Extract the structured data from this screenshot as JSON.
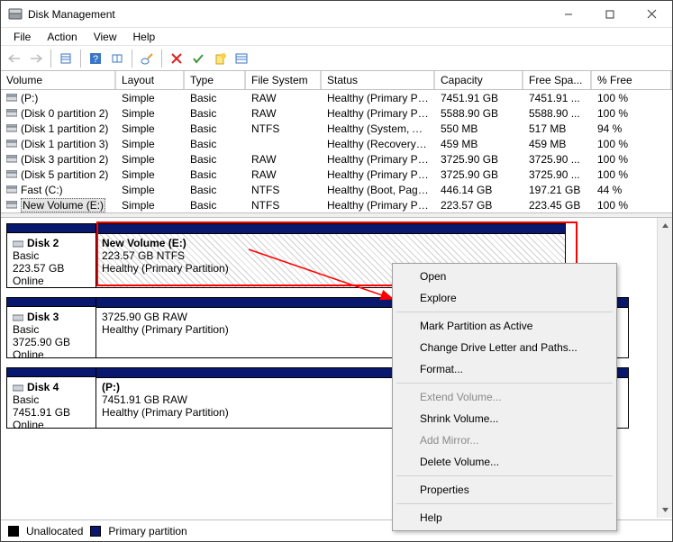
{
  "title": "Disk Management",
  "menus": [
    "File",
    "Action",
    "View",
    "Help"
  ],
  "columns": [
    "Volume",
    "Layout",
    "Type",
    "File System",
    "Status",
    "Capacity",
    "Free Spa...",
    "% Free"
  ],
  "volumes": [
    {
      "name": "(P:)",
      "layout": "Simple",
      "type": "Basic",
      "fs": "RAW",
      "status": "Healthy (Primary Par...",
      "cap": "7451.91 GB",
      "free": "7451.91 ...",
      "pct": "100 %"
    },
    {
      "name": "(Disk 0 partition 2)",
      "layout": "Simple",
      "type": "Basic",
      "fs": "RAW",
      "status": "Healthy (Primary Par...",
      "cap": "5588.90 GB",
      "free": "5588.90 ...",
      "pct": "100 %"
    },
    {
      "name": "(Disk 1 partition 2)",
      "layout": "Simple",
      "type": "Basic",
      "fs": "NTFS",
      "status": "Healthy (System, Act...",
      "cap": "550 MB",
      "free": "517 MB",
      "pct": "94 %"
    },
    {
      "name": "(Disk 1 partition 3)",
      "layout": "Simple",
      "type": "Basic",
      "fs": "",
      "status": "Healthy (Recovery Par...",
      "cap": "459 MB",
      "free": "459 MB",
      "pct": "100 %"
    },
    {
      "name": "(Disk 3 partition 2)",
      "layout": "Simple",
      "type": "Basic",
      "fs": "RAW",
      "status": "Healthy (Primary Par...",
      "cap": "3725.90 GB",
      "free": "3725.90 ...",
      "pct": "100 %"
    },
    {
      "name": "(Disk 5 partition 2)",
      "layout": "Simple",
      "type": "Basic",
      "fs": "RAW",
      "status": "Healthy (Primary Par...",
      "cap": "3725.90 GB",
      "free": "3725.90 ...",
      "pct": "100 %"
    },
    {
      "name": "Fast (C:)",
      "layout": "Simple",
      "type": "Basic",
      "fs": "NTFS",
      "status": "Healthy (Boot, Page ...",
      "cap": "446.14 GB",
      "free": "197.21 GB",
      "pct": "44 %"
    },
    {
      "name": "New Volume (E:)",
      "layout": "Simple",
      "type": "Basic",
      "fs": "NTFS",
      "status": "Healthy (Primary Par...",
      "cap": "223.57 GB",
      "free": "223.45 GB",
      "pct": "100 %",
      "selected": true
    }
  ],
  "disks": [
    {
      "label": "Disk 2",
      "kind": "Basic",
      "size": "223.57 GB",
      "state": "Online",
      "part": {
        "name": "New Volume  (E:)",
        "line1": "223.57 GB NTFS",
        "line2": "Healthy (Primary Partition)",
        "hatched": true,
        "highlighted": true
      }
    },
    {
      "label": "Disk 3",
      "kind": "Basic",
      "size": "3725.90 GB",
      "state": "Online",
      "part": {
        "name": "",
        "line1": "3725.90 GB RAW",
        "line2": "Healthy (Primary Partition)",
        "hatched": false
      }
    },
    {
      "label": "Disk 4",
      "kind": "Basic",
      "size": "7451.91 GB",
      "state": "Online",
      "part": {
        "name": "(P:)",
        "line1": "7451.91 GB RAW",
        "line2": "Healthy (Primary Partition)",
        "hatched": false
      }
    }
  ],
  "legend": {
    "unalloc": "Unallocated",
    "primary": "Primary partition"
  },
  "context_menu": [
    {
      "label": "Open",
      "enabled": true
    },
    {
      "label": "Explore",
      "enabled": true
    },
    {
      "sep": true
    },
    {
      "label": "Mark Partition as Active",
      "enabled": true
    },
    {
      "label": "Change Drive Letter and Paths...",
      "enabled": true
    },
    {
      "label": "Format...",
      "enabled": true
    },
    {
      "sep": true
    },
    {
      "label": "Extend Volume...",
      "enabled": false
    },
    {
      "label": "Shrink Volume...",
      "enabled": true
    },
    {
      "label": "Add Mirror...",
      "enabled": false
    },
    {
      "label": "Delete Volume...",
      "enabled": true
    },
    {
      "sep": true
    },
    {
      "label": "Properties",
      "enabled": true
    },
    {
      "sep": true
    },
    {
      "label": "Help",
      "enabled": true
    }
  ]
}
